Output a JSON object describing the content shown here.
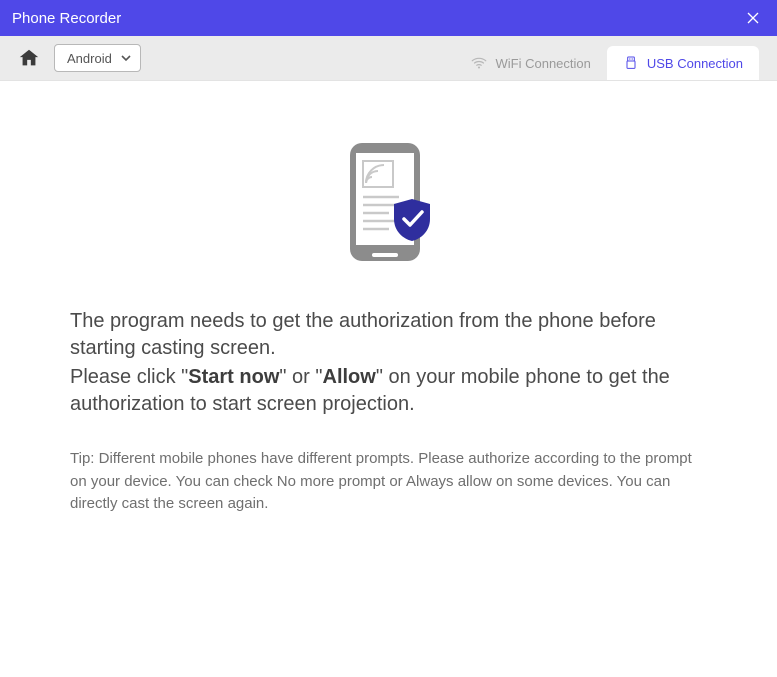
{
  "titlebar": {
    "title": "Phone Recorder"
  },
  "topbar": {
    "platform_label": "Android"
  },
  "tabs": {
    "wifi": "WiFi Connection",
    "usb": "USB Connection"
  },
  "message": {
    "line1": "The program needs to get the authorization from the phone before starting casting screen.",
    "line2_a": "Please click \"",
    "line2_b": "Start now",
    "line2_c": "\" or \"",
    "line2_d": "Allow",
    "line2_e": "\" on your mobile phone to get the authorization to start screen projection."
  },
  "tip": "Tip: Different mobile phones have different prompts. Please authorize according to the prompt on your device. You can check No more prompt or Always allow on some devices. You can directly cast the screen again."
}
